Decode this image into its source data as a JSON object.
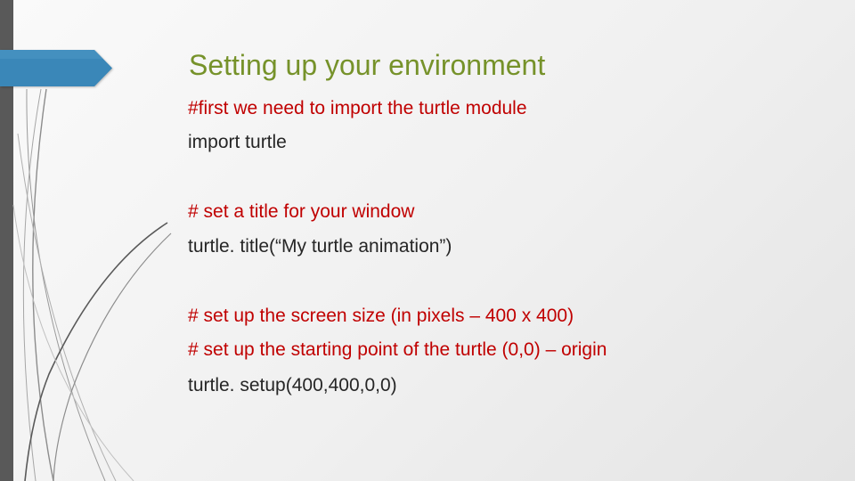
{
  "slide": {
    "title": "Setting up your environment",
    "lines": [
      {
        "text": "#first we need to import the turtle module",
        "kind": "comment-red"
      },
      {
        "text": "import turtle",
        "kind": "code"
      },
      {
        "text": "# set a title for your window",
        "kind": "comment-red"
      },
      {
        "text": "turtle. title(“My turtle animation”)",
        "kind": "code"
      },
      {
        "text": "# set up the screen size (in pixels – 400 x 400)",
        "kind": "comment-red"
      },
      {
        "text": "# set up the starting point of the turtle (0,0) – origin",
        "kind": "comment-red"
      },
      {
        "text": "turtle. setup(400,400,0,0)",
        "kind": "code"
      }
    ]
  },
  "colors": {
    "title": "#76922a",
    "comment": "#c00000",
    "code": "#262626",
    "accent_tab": "#3a87b8",
    "side_bar": "#595959"
  }
}
